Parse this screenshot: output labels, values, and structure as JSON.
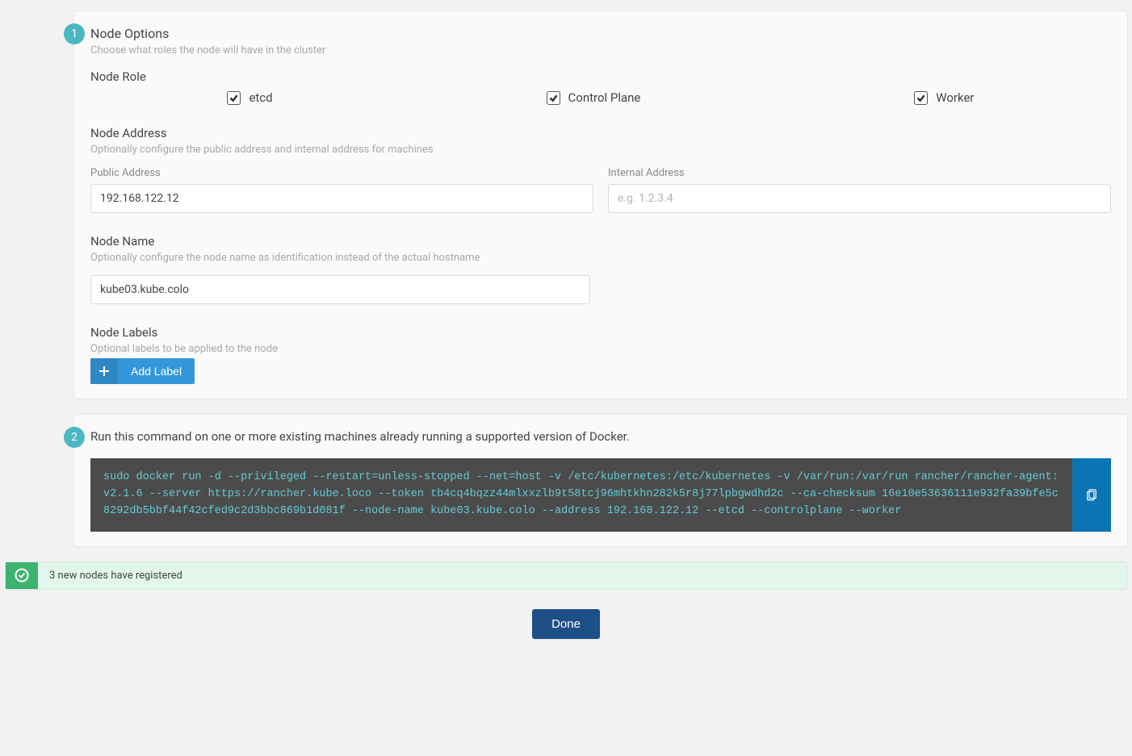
{
  "step1": {
    "badge": "1",
    "title": "Node Options",
    "subtitle": "Choose what roles the node will have in the cluster",
    "node_role": {
      "heading": "Node Role",
      "roles": [
        {
          "label": "etcd",
          "checked": true
        },
        {
          "label": "Control Plane",
          "checked": true
        },
        {
          "label": "Worker",
          "checked": true
        }
      ]
    },
    "node_address": {
      "heading": "Node Address",
      "subtext": "Optionally configure the public address and internal address for machines",
      "public": {
        "label": "Public Address",
        "value": "192.168.122.12"
      },
      "internal": {
        "label": "Internal Address",
        "placeholder": "e.g. 1.2.3.4",
        "value": ""
      }
    },
    "node_name": {
      "heading": "Node Name",
      "subtext": "Optionally configure the node name as identification instead of the actual hostname",
      "value": "kube03.kube.colo"
    },
    "node_labels": {
      "heading": "Node Labels",
      "subtext": "Optional labels to be applied to the node",
      "add_button": "Add Label"
    }
  },
  "step2": {
    "badge": "2",
    "instruction": "Run this command on one or more existing machines already running a supported version of Docker.",
    "command": "sudo docker run -d --privileged --restart=unless-stopped --net=host -v /etc/kubernetes:/etc/kubernetes -v /var/run:/var/run rancher/rancher-agent:v2.1.6 --server https://rancher.kube.loco --token tb4cq4bqzz44mlxxzlb9t58tcj96mhtkhn282k5r8j77lpbgwdhd2c --ca-checksum 16e10e53636111e932fa39bfe5c8292db5bbf44f42cfed9c2d3bbc869b1d081f --node-name kube03.kube.colo --address 192.168.122.12 --etcd --controlplane --worker"
  },
  "banner": {
    "text": "3 new nodes have registered"
  },
  "done": {
    "label": "Done"
  }
}
